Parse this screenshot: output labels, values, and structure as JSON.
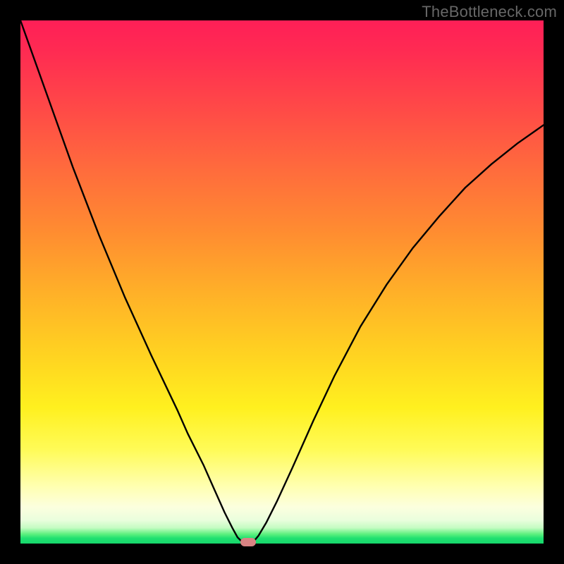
{
  "watermark": "TheBottleneck.com",
  "chart_data": {
    "type": "line",
    "title": "",
    "xlabel": "",
    "ylabel": "",
    "xlim": [
      0,
      1
    ],
    "ylim": [
      0,
      1
    ],
    "legend": false,
    "grid": false,
    "background_gradient": {
      "orientation": "vertical",
      "stops": [
        {
          "pos": 0.0,
          "desc": "red-pink",
          "hex": "#ff1f57"
        },
        {
          "pos": 0.3,
          "desc": "orange",
          "hex": "#ff7a37"
        },
        {
          "pos": 0.6,
          "desc": "amber",
          "hex": "#ffc424"
        },
        {
          "pos": 0.8,
          "desc": "yellow",
          "hex": "#fff44a"
        },
        {
          "pos": 0.93,
          "desc": "pale-yellow",
          "hex": "#fbffd8"
        },
        {
          "pos": 1.0,
          "desc": "green",
          "hex": "#17d86c"
        }
      ]
    },
    "series": [
      {
        "name": "bottleneck-curve",
        "color": "#000000",
        "x": [
          0.0,
          0.05,
          0.1,
          0.15,
          0.2,
          0.25,
          0.3,
          0.32,
          0.35,
          0.37,
          0.39,
          0.405,
          0.415,
          0.425,
          0.432,
          0.438,
          0.445,
          0.455,
          0.47,
          0.49,
          0.52,
          0.56,
          0.6,
          0.65,
          0.7,
          0.75,
          0.8,
          0.85,
          0.9,
          0.95,
          1.0
        ],
        "y": [
          1.0,
          0.86,
          0.72,
          0.59,
          0.47,
          0.36,
          0.255,
          0.21,
          0.15,
          0.105,
          0.06,
          0.03,
          0.012,
          0.002,
          0.0,
          0.0,
          0.003,
          0.015,
          0.04,
          0.08,
          0.145,
          0.235,
          0.32,
          0.415,
          0.495,
          0.565,
          0.625,
          0.68,
          0.725,
          0.765,
          0.8
        ]
      }
    ],
    "marker": {
      "x": 0.435,
      "y": 0.003,
      "color": "#d98383",
      "shape": "pill"
    }
  }
}
